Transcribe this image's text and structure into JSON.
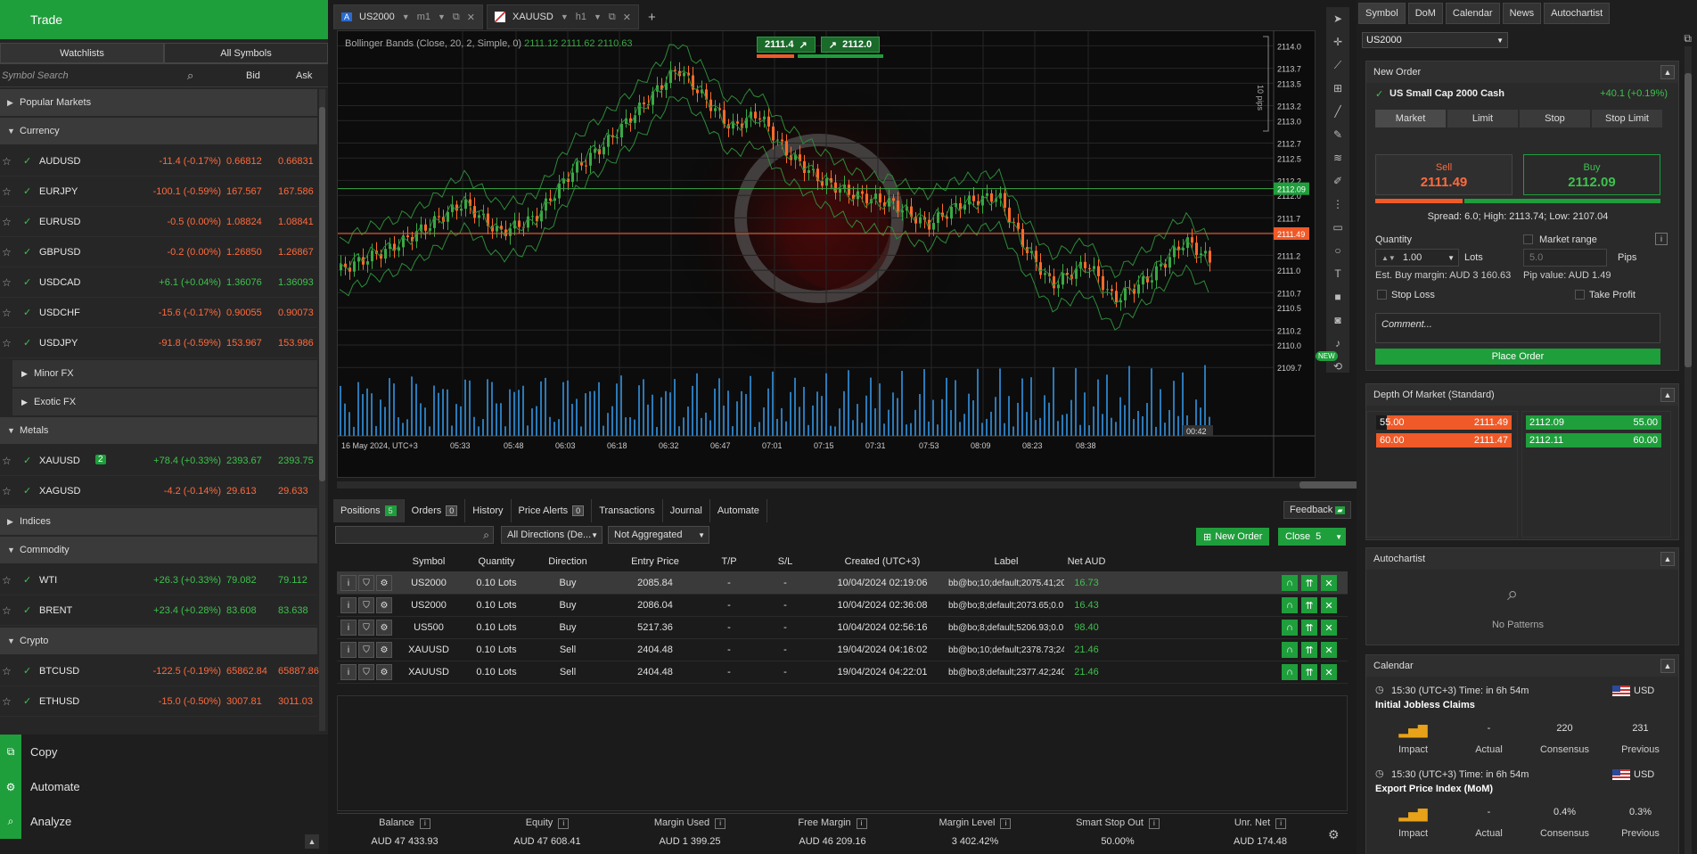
{
  "left": {
    "header": "Trade",
    "tabs": [
      "Watchlists",
      "All Symbols"
    ],
    "search_placeholder": "Symbol Search",
    "col_bid": "Bid",
    "col_ask": "Ask",
    "groups": {
      "popular": "Popular Markets",
      "currency": "Currency",
      "minor": "Minor FX",
      "exotic": "Exotic FX",
      "metals": "Metals",
      "indices": "Indices",
      "commodity": "Commodity",
      "crypto": "Crypto"
    },
    "currency_rows": [
      {
        "sym": "AUDUSD",
        "chg": "-11.4 (-0.17%)",
        "bid": "0.66812",
        "ask": "0.66831",
        "dir": "down"
      },
      {
        "sym": "EURJPY",
        "chg": "-100.1 (-0.59%)",
        "bid": "167.567",
        "ask": "167.586",
        "dir": "down"
      },
      {
        "sym": "EURUSD",
        "chg": "-0.5 (0.00%)",
        "bid": "1.08824",
        "ask": "1.08841",
        "dir": "down"
      },
      {
        "sym": "GBPUSD",
        "chg": "-0.2 (0.00%)",
        "bid": "1.26850",
        "ask": "1.26867",
        "dir": "down"
      },
      {
        "sym": "USDCAD",
        "chg": "+6.1 (+0.04%)",
        "bid": "1.36076",
        "ask": "1.36093",
        "dir": "up"
      },
      {
        "sym": "USDCHF",
        "chg": "-15.6 (-0.17%)",
        "bid": "0.90055",
        "ask": "0.90073",
        "dir": "down"
      },
      {
        "sym": "USDJPY",
        "chg": "-91.8 (-0.59%)",
        "bid": "153.967",
        "ask": "153.986",
        "dir": "down"
      }
    ],
    "metal_rows": [
      {
        "sym": "XAUUSD",
        "badge": "2",
        "chg": "+78.4 (+0.33%)",
        "bid": "2393.67",
        "ask": "2393.75",
        "dir": "up"
      },
      {
        "sym": "XAGUSD",
        "badge": "",
        "chg": "-4.2 (-0.14%)",
        "bid": "29.613",
        "ask": "29.633",
        "dir": "down"
      }
    ],
    "commodity_rows": [
      {
        "sym": "WTI",
        "chg": "+26.3 (+0.33%)",
        "bid": "79.082",
        "ask": "79.112",
        "dir": "up"
      },
      {
        "sym": "BRENT",
        "chg": "+23.4 (+0.28%)",
        "bid": "83.608",
        "ask": "83.638",
        "dir": "up"
      }
    ],
    "crypto_rows": [
      {
        "sym": "BTCUSD",
        "chg": "-122.5 (-0.19%)",
        "bid": "65862.84",
        "ask": "65887.86",
        "dir": "down"
      },
      {
        "sym": "ETHUSD",
        "chg": "-15.0 (-0.50%)",
        "bid": "3007.81",
        "ask": "3011.03",
        "dir": "down"
      }
    ],
    "bottom": [
      "Copy",
      "Automate",
      "Analyze"
    ]
  },
  "chart_tabs": [
    {
      "symbol": "US2000",
      "tf": "m1"
    },
    {
      "symbol": "XAUUSD",
      "tf": "h1"
    }
  ],
  "chart": {
    "indicator_label": "Bollinger Bands (Close, 20, 2, Simple, 0)",
    "indicator_values": "2111.12  2111.62  2110.63",
    "sell_btn": "2111.4",
    "buy_btn": "2112.0",
    "pips_label": "10 pips",
    "y_ticks": [
      "2114.0",
      "2113.7",
      "2113.5",
      "2113.2",
      "2113.0",
      "2112.7",
      "2112.5",
      "2112.2",
      "2112.0",
      "2111.7",
      "2111.5",
      "2111.2",
      "2111.0",
      "2110.7",
      "2110.5",
      "2110.2",
      "2110.0",
      "2109.7"
    ],
    "x_ticks": [
      "16 May 2024, UTC+3",
      "05:33",
      "05:48",
      "06:03",
      "06:18",
      "06:32",
      "06:47",
      "07:01",
      "07:15",
      "07:31",
      "07:53",
      "08:09",
      "08:23",
      "08:38"
    ],
    "ask_tag": "2112.09",
    "bid_tag": "2111.49",
    "countdown": "00:42",
    "new_badge": "NEW"
  },
  "bottom": {
    "tabs": [
      {
        "label": "Positions",
        "count": "5"
      },
      {
        "label": "Orders",
        "count": "0"
      },
      {
        "label": "History",
        "count": ""
      },
      {
        "label": "Price Alerts",
        "count": "0"
      },
      {
        "label": "Transactions",
        "count": ""
      },
      {
        "label": "Journal",
        "count": ""
      },
      {
        "label": "Automate",
        "count": ""
      }
    ],
    "feedback": "Feedback",
    "direction_filter": "All Directions (De...",
    "aggregation_filter": "Not Aggregated",
    "new_order": "New Order",
    "close_label": "Close",
    "close_count": "5",
    "headers": [
      "Symbol",
      "Quantity",
      "Direction",
      "Entry Price",
      "T/P",
      "S/L",
      "Created (UTC+3)",
      "Label",
      "Net AUD"
    ],
    "rows": [
      {
        "symbol": "US2000",
        "qty": "0.10 Lots",
        "dir": "Buy",
        "entry": "2085.84",
        "tp": "-",
        "sl": "-",
        "created": "10/04/2024 02:19:06",
        "label": "bb@bo;10;default;2075.41;205...",
        "net": "16.73"
      },
      {
        "symbol": "US2000",
        "qty": "0.10 Lots",
        "dir": "Buy",
        "entry": "2086.04",
        "tp": "-",
        "sl": "-",
        "created": "10/04/2024 02:36:08",
        "label": "bb@bo;8;default;2073.65;0.0;...",
        "net": "16.43"
      },
      {
        "symbol": "US500",
        "qty": "0.10 Lots",
        "dir": "Buy",
        "entry": "5217.36",
        "tp": "-",
        "sl": "-",
        "created": "10/04/2024 02:56:16",
        "label": "bb@bo;8;default;5206.93;0.0;...",
        "net": "98.40"
      },
      {
        "symbol": "XAUUSD",
        "qty": "0.10 Lots",
        "dir": "Sell",
        "entry": "2404.48",
        "tp": "-",
        "sl": "-",
        "created": "19/04/2024 04:16:02",
        "label": "bb@bo;10;default;2378.73;240...",
        "net": "21.46"
      },
      {
        "symbol": "XAUUSD",
        "qty": "0.10 Lots",
        "dir": "Sell",
        "entry": "2404.48",
        "tp": "-",
        "sl": "-",
        "created": "19/04/2024 04:22:01",
        "label": "bb@bo;8;default;2377.42;2401...",
        "net": "21.46"
      }
    ],
    "summary": [
      {
        "label": "Balance",
        "value": "AUD 47 433.93"
      },
      {
        "label": "Equity",
        "value": "AUD 47 608.41"
      },
      {
        "label": "Margin Used",
        "value": "AUD 1 399.25"
      },
      {
        "label": "Free Margin",
        "value": "AUD 46 209.16"
      },
      {
        "label": "Margin Level",
        "value": "3 402.42%"
      },
      {
        "label": "Smart Stop Out",
        "value": "50.00%"
      },
      {
        "label": "Unr. Net",
        "value": "AUD 174.48"
      }
    ]
  },
  "right": {
    "tabs": [
      "Symbol",
      "DoM",
      "Calendar",
      "News",
      "Autochartist"
    ],
    "symbol_select": "US2000",
    "new_order": {
      "title": "New Order",
      "instrument": "US Small Cap 2000 Cash",
      "change": "+40.1 (+0.19%)",
      "types": [
        "Market",
        "Limit",
        "Stop",
        "Stop Limit"
      ],
      "sell_label": "Sell",
      "sell_price": "2111.49",
      "buy_label": "Buy",
      "buy_price": "2112.09",
      "spread": "Spread: 6.0; High: 2113.74; Low: 2107.04",
      "quantity_label": "Quantity",
      "market_range_label": "Market range",
      "quantity_value": "1.00",
      "lots_label": "Lots",
      "range_value": "5.0",
      "pips_label": "Pips",
      "margin_info": "Est. Buy margin: AUD 3 160.63",
      "pip_value": "Pip value: AUD 1.49",
      "stop_loss": "Stop Loss",
      "take_profit": "Take Profit",
      "comment_placeholder": "Comment...",
      "place_order": "Place Order"
    },
    "dom": {
      "title": "Depth Of Market (Standard)",
      "sell": [
        {
          "vol": "55.00",
          "price": "2111.49"
        },
        {
          "vol": "60.00",
          "price": "2111.47"
        }
      ],
      "buy": [
        {
          "price": "2112.09",
          "vol": "55.00"
        },
        {
          "price": "2112.11",
          "vol": "60.00"
        }
      ]
    },
    "autochartist": {
      "title": "Autochartist",
      "empty": "No Patterns"
    },
    "calendar": {
      "title": "Calendar",
      "events": [
        {
          "time": "15:30 (UTC+3)  Time:  in 6h 54m",
          "currency": "USD",
          "name": "Initial Jobless Claims",
          "actual": "-",
          "consensus": "220",
          "previous": "231"
        },
        {
          "time": "15:30 (UTC+3)  Time:  in 6h 54m",
          "currency": "USD",
          "name": "Export Price Index (MoM)",
          "actual": "-",
          "consensus": "0.4%",
          "previous": "0.3%"
        }
      ],
      "stat_labels": [
        "Impact",
        "Actual",
        "Consensus",
        "Previous"
      ]
    }
  },
  "colors": {
    "accent_green": "#1f9e3c",
    "up": "#3ec14d",
    "down": "#ff6a3d",
    "sell_orange": "#f05a28"
  }
}
